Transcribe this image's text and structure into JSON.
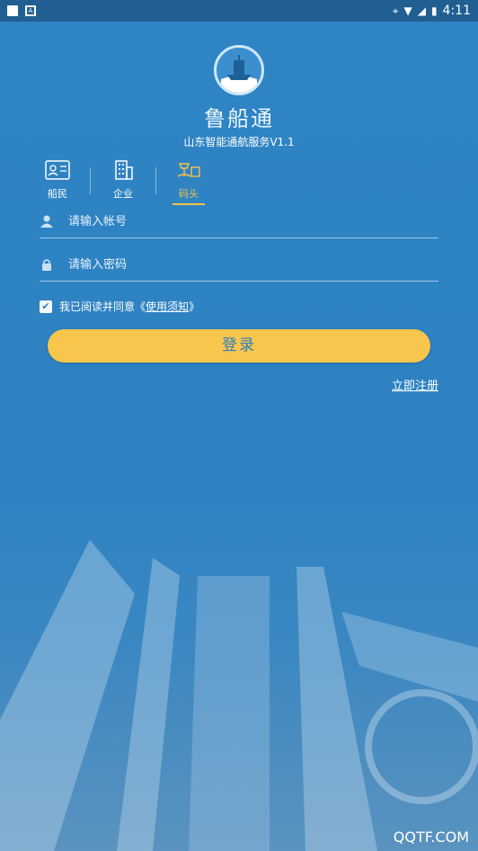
{
  "status_bar": {
    "time": "4:11"
  },
  "app": {
    "name": "鲁船通",
    "subtitle": "山东智能通航服务V1.1"
  },
  "tabs": [
    {
      "label": "船民",
      "icon": "id-card-icon",
      "active": false
    },
    {
      "label": "企业",
      "icon": "building-icon",
      "active": false
    },
    {
      "label": "码头",
      "icon": "dock-icon",
      "active": true
    }
  ],
  "form": {
    "username_placeholder": "请输入帐号",
    "password_placeholder": "请输入密码",
    "agree_text": "我已阅读并同意《",
    "agree_link": "使用须知",
    "agree_close": "》",
    "login_label": "登录",
    "register_label": "立即注册"
  },
  "colors": {
    "accent": "#f9c64d",
    "background": "#2f84c4",
    "active_tab": "#f6c44a"
  },
  "watermark": "QQTF.COM"
}
